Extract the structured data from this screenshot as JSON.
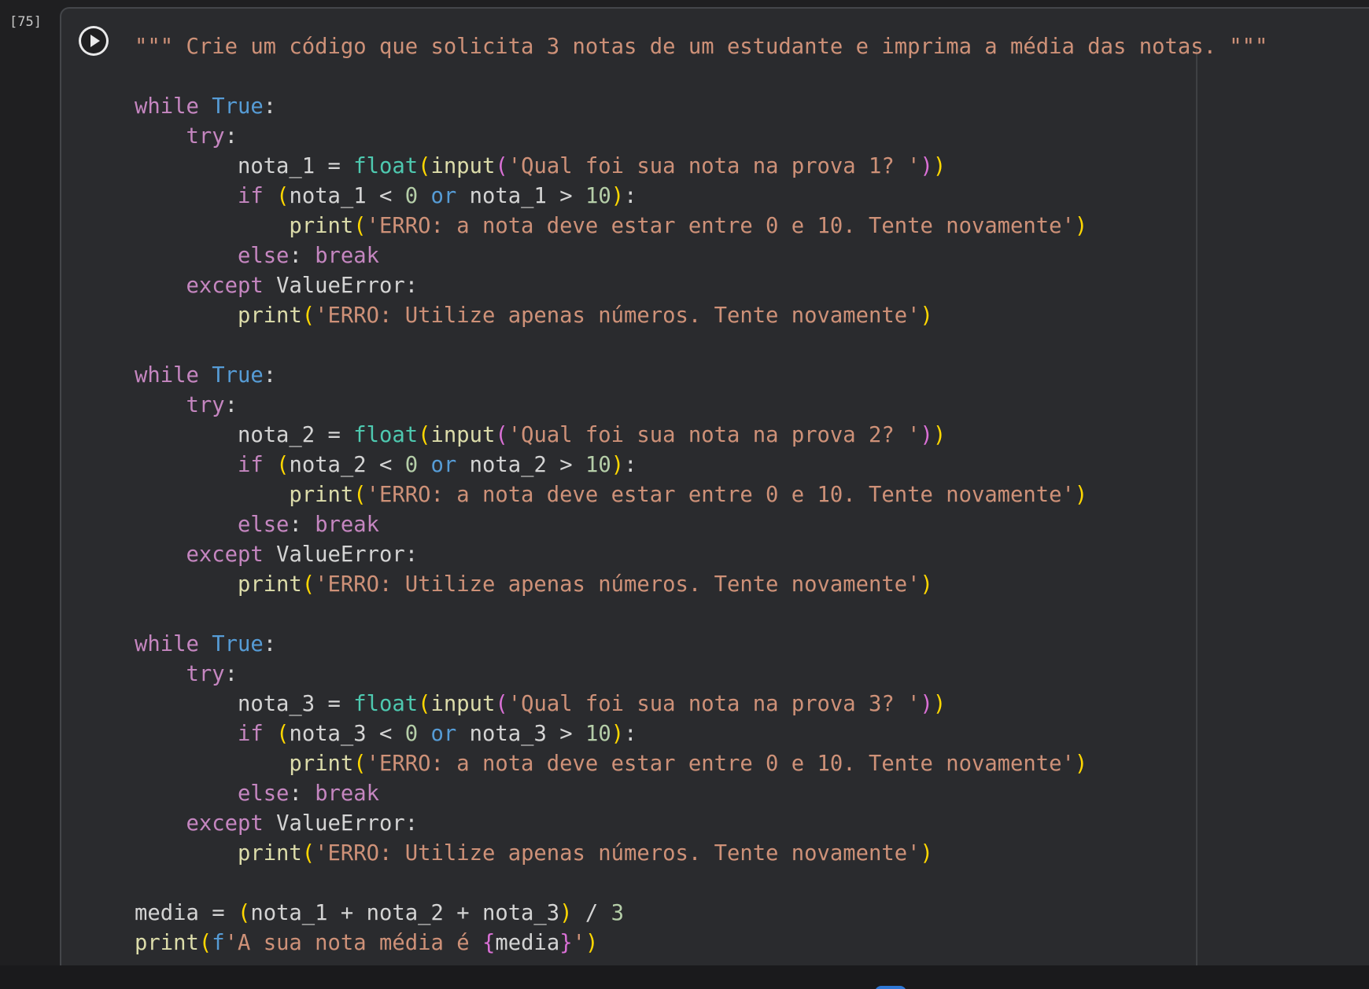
{
  "cell": {
    "execution_count": "[75]",
    "run_button_icon": "play-icon"
  },
  "code_lines": [
    [
      {
        "t": "\"\"\" Crie um código que solicita 3 notas de um estudante e imprima a média das notas. \"\"\"",
        "c": "st"
      }
    ],
    [],
    [
      {
        "t": "while",
        "c": "kw"
      },
      {
        "t": " ",
        "c": "op"
      },
      {
        "t": "True",
        "c": "kb"
      },
      {
        "t": ":",
        "c": "op"
      }
    ],
    [
      {
        "t": "    ",
        "c": "op"
      },
      {
        "t": "try",
        "c": "kw"
      },
      {
        "t": ":",
        "c": "op"
      }
    ],
    [
      {
        "t": "        ",
        "c": "op"
      },
      {
        "t": "nota_1",
        "c": "vr"
      },
      {
        "t": " = ",
        "c": "op"
      },
      {
        "t": "float",
        "c": "bi"
      },
      {
        "t": "(",
        "c": "p1"
      },
      {
        "t": "input",
        "c": "fn"
      },
      {
        "t": "(",
        "c": "p2"
      },
      {
        "t": "'Qual foi sua nota na prova 1? '",
        "c": "st"
      },
      {
        "t": ")",
        "c": "p2"
      },
      {
        "t": ")",
        "c": "p1"
      }
    ],
    [
      {
        "t": "        ",
        "c": "op"
      },
      {
        "t": "if",
        "c": "kw"
      },
      {
        "t": " ",
        "c": "op"
      },
      {
        "t": "(",
        "c": "p1"
      },
      {
        "t": "nota_1",
        "c": "vr"
      },
      {
        "t": " < ",
        "c": "op"
      },
      {
        "t": "0",
        "c": "nm"
      },
      {
        "t": " ",
        "c": "op"
      },
      {
        "t": "or",
        "c": "kb"
      },
      {
        "t": " ",
        "c": "op"
      },
      {
        "t": "nota_1",
        "c": "vr"
      },
      {
        "t": " > ",
        "c": "op"
      },
      {
        "t": "10",
        "c": "nm"
      },
      {
        "t": ")",
        "c": "p1"
      },
      {
        "t": ":",
        "c": "op"
      }
    ],
    [
      {
        "t": "            ",
        "c": "op"
      },
      {
        "t": "print",
        "c": "fn"
      },
      {
        "t": "(",
        "c": "p1"
      },
      {
        "t": "'ERRO: a nota deve estar entre 0 e 10. Tente novamente'",
        "c": "st"
      },
      {
        "t": ")",
        "c": "p1"
      }
    ],
    [
      {
        "t": "        ",
        "c": "op"
      },
      {
        "t": "else",
        "c": "kw"
      },
      {
        "t": ": ",
        "c": "op"
      },
      {
        "t": "break",
        "c": "kw"
      }
    ],
    [
      {
        "t": "    ",
        "c": "op"
      },
      {
        "t": "except",
        "c": "kw"
      },
      {
        "t": " ValueError:",
        "c": "op"
      }
    ],
    [
      {
        "t": "        ",
        "c": "op"
      },
      {
        "t": "print",
        "c": "fn"
      },
      {
        "t": "(",
        "c": "p1"
      },
      {
        "t": "'ERRO: Utilize apenas números. Tente novamente'",
        "c": "st"
      },
      {
        "t": ")",
        "c": "p1"
      }
    ],
    [],
    [
      {
        "t": "while",
        "c": "kw"
      },
      {
        "t": " ",
        "c": "op"
      },
      {
        "t": "True",
        "c": "kb"
      },
      {
        "t": ":",
        "c": "op"
      }
    ],
    [
      {
        "t": "    ",
        "c": "op"
      },
      {
        "t": "try",
        "c": "kw"
      },
      {
        "t": ":",
        "c": "op"
      }
    ],
    [
      {
        "t": "        ",
        "c": "op"
      },
      {
        "t": "nota_2",
        "c": "vr"
      },
      {
        "t": " = ",
        "c": "op"
      },
      {
        "t": "float",
        "c": "bi"
      },
      {
        "t": "(",
        "c": "p1"
      },
      {
        "t": "input",
        "c": "fn"
      },
      {
        "t": "(",
        "c": "p2"
      },
      {
        "t": "'Qual foi sua nota na prova 2? '",
        "c": "st"
      },
      {
        "t": ")",
        "c": "p2"
      },
      {
        "t": ")",
        "c": "p1"
      }
    ],
    [
      {
        "t": "        ",
        "c": "op"
      },
      {
        "t": "if",
        "c": "kw"
      },
      {
        "t": " ",
        "c": "op"
      },
      {
        "t": "(",
        "c": "p1"
      },
      {
        "t": "nota_2",
        "c": "vr"
      },
      {
        "t": " < ",
        "c": "op"
      },
      {
        "t": "0",
        "c": "nm"
      },
      {
        "t": " ",
        "c": "op"
      },
      {
        "t": "or",
        "c": "kb"
      },
      {
        "t": " ",
        "c": "op"
      },
      {
        "t": "nota_2",
        "c": "vr"
      },
      {
        "t": " > ",
        "c": "op"
      },
      {
        "t": "10",
        "c": "nm"
      },
      {
        "t": ")",
        "c": "p1"
      },
      {
        "t": ":",
        "c": "op"
      }
    ],
    [
      {
        "t": "            ",
        "c": "op"
      },
      {
        "t": "print",
        "c": "fn"
      },
      {
        "t": "(",
        "c": "p1"
      },
      {
        "t": "'ERRO: a nota deve estar entre 0 e 10. Tente novamente'",
        "c": "st"
      },
      {
        "t": ")",
        "c": "p1"
      }
    ],
    [
      {
        "t": "        ",
        "c": "op"
      },
      {
        "t": "else",
        "c": "kw"
      },
      {
        "t": ": ",
        "c": "op"
      },
      {
        "t": "break",
        "c": "kw"
      }
    ],
    [
      {
        "t": "    ",
        "c": "op"
      },
      {
        "t": "except",
        "c": "kw"
      },
      {
        "t": " ValueError:",
        "c": "op"
      }
    ],
    [
      {
        "t": "        ",
        "c": "op"
      },
      {
        "t": "print",
        "c": "fn"
      },
      {
        "t": "(",
        "c": "p1"
      },
      {
        "t": "'ERRO: Utilize apenas números. Tente novamente'",
        "c": "st"
      },
      {
        "t": ")",
        "c": "p1"
      }
    ],
    [],
    [
      {
        "t": "while",
        "c": "kw"
      },
      {
        "t": " ",
        "c": "op"
      },
      {
        "t": "True",
        "c": "kb"
      },
      {
        "t": ":",
        "c": "op"
      }
    ],
    [
      {
        "t": "    ",
        "c": "op"
      },
      {
        "t": "try",
        "c": "kw"
      },
      {
        "t": ":",
        "c": "op"
      }
    ],
    [
      {
        "t": "        ",
        "c": "op"
      },
      {
        "t": "nota_3",
        "c": "vr"
      },
      {
        "t": " = ",
        "c": "op"
      },
      {
        "t": "float",
        "c": "bi"
      },
      {
        "t": "(",
        "c": "p1"
      },
      {
        "t": "input",
        "c": "fn"
      },
      {
        "t": "(",
        "c": "p2"
      },
      {
        "t": "'Qual foi sua nota na prova 3? '",
        "c": "st"
      },
      {
        "t": ")",
        "c": "p2"
      },
      {
        "t": ")",
        "c": "p1"
      }
    ],
    [
      {
        "t": "        ",
        "c": "op"
      },
      {
        "t": "if",
        "c": "kw"
      },
      {
        "t": " ",
        "c": "op"
      },
      {
        "t": "(",
        "c": "p1"
      },
      {
        "t": "nota_3",
        "c": "vr"
      },
      {
        "t": " < ",
        "c": "op"
      },
      {
        "t": "0",
        "c": "nm"
      },
      {
        "t": " ",
        "c": "op"
      },
      {
        "t": "or",
        "c": "kb"
      },
      {
        "t": " ",
        "c": "op"
      },
      {
        "t": "nota_3",
        "c": "vr"
      },
      {
        "t": " > ",
        "c": "op"
      },
      {
        "t": "10",
        "c": "nm"
      },
      {
        "t": ")",
        "c": "p1"
      },
      {
        "t": ":",
        "c": "op"
      }
    ],
    [
      {
        "t": "            ",
        "c": "op"
      },
      {
        "t": "print",
        "c": "fn"
      },
      {
        "t": "(",
        "c": "p1"
      },
      {
        "t": "'ERRO: a nota deve estar entre 0 e 10. Tente novamente'",
        "c": "st"
      },
      {
        "t": ")",
        "c": "p1"
      }
    ],
    [
      {
        "t": "        ",
        "c": "op"
      },
      {
        "t": "else",
        "c": "kw"
      },
      {
        "t": ": ",
        "c": "op"
      },
      {
        "t": "break",
        "c": "kw"
      }
    ],
    [
      {
        "t": "    ",
        "c": "op"
      },
      {
        "t": "except",
        "c": "kw"
      },
      {
        "t": " ValueError:",
        "c": "op"
      }
    ],
    [
      {
        "t": "        ",
        "c": "op"
      },
      {
        "t": "print",
        "c": "fn"
      },
      {
        "t": "(",
        "c": "p1"
      },
      {
        "t": "'ERRO: Utilize apenas números. Tente novamente'",
        "c": "st"
      },
      {
        "t": ")",
        "c": "p1"
      }
    ],
    [],
    [
      {
        "t": "media",
        "c": "vr"
      },
      {
        "t": " = ",
        "c": "op"
      },
      {
        "t": "(",
        "c": "p1"
      },
      {
        "t": "nota_1 + nota_2 + nota_3",
        "c": "vr"
      },
      {
        "t": ")",
        "c": "p1"
      },
      {
        "t": " / ",
        "c": "op"
      },
      {
        "t": "3",
        "c": "nm"
      }
    ],
    [
      {
        "t": "print",
        "c": "fn"
      },
      {
        "t": "(",
        "c": "p1"
      },
      {
        "t": "f",
        "c": "fp"
      },
      {
        "t": "'A sua nota média é ",
        "c": "st"
      },
      {
        "t": "{",
        "c": "p2"
      },
      {
        "t": "media",
        "c": "vr"
      },
      {
        "t": "}",
        "c": "p2"
      },
      {
        "t": "'",
        "c": "st"
      },
      {
        "t": ")",
        "c": "p1"
      }
    ]
  ]
}
